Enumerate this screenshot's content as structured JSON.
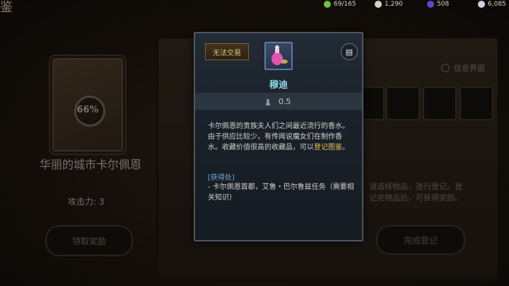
{
  "header": {
    "corner_title": "鉴",
    "resources": [
      {
        "icon": "green-orb-icon",
        "value": "69/165",
        "color": "#6fbf3f"
      },
      {
        "icon": "pearl-icon",
        "value": "1,290",
        "color": "#d8d0c4"
      },
      {
        "icon": "purple-gem-icon",
        "value": "508",
        "color": "#6a3fd0"
      },
      {
        "icon": "silver-coin-icon",
        "value": "6,085",
        "color": "#c8d2e0"
      }
    ]
  },
  "left_panel": {
    "progress_label": "66%",
    "progress": 0.66,
    "title": "华丽的城市卡尔佩恩",
    "attack": "攻击力: 3",
    "button_label": "领取奖励"
  },
  "right_panel": {
    "info_toggle_label": "信息界面",
    "hint": "请选择物品，进行登记。登记完物品后，可获得奖励。",
    "button_label": "完成登记"
  },
  "tooltip": {
    "trade_badge": "无法交易",
    "item_name": "穆迪",
    "weight": "0.5",
    "desc_main": "卡尔佩恩的贵族夫人们之间最近流行的香水。由于供应比较少，有传闻说魔女们在制作香水。收藏价值很高的收藏品，可以",
    "desc_link": "登记图鉴",
    "desc_end": "。",
    "source_header": "[获得处]",
    "source_text": " - 卡尔佩恩首都，艾鲁・巴尔鲁兹任务（需要相关知识）"
  }
}
